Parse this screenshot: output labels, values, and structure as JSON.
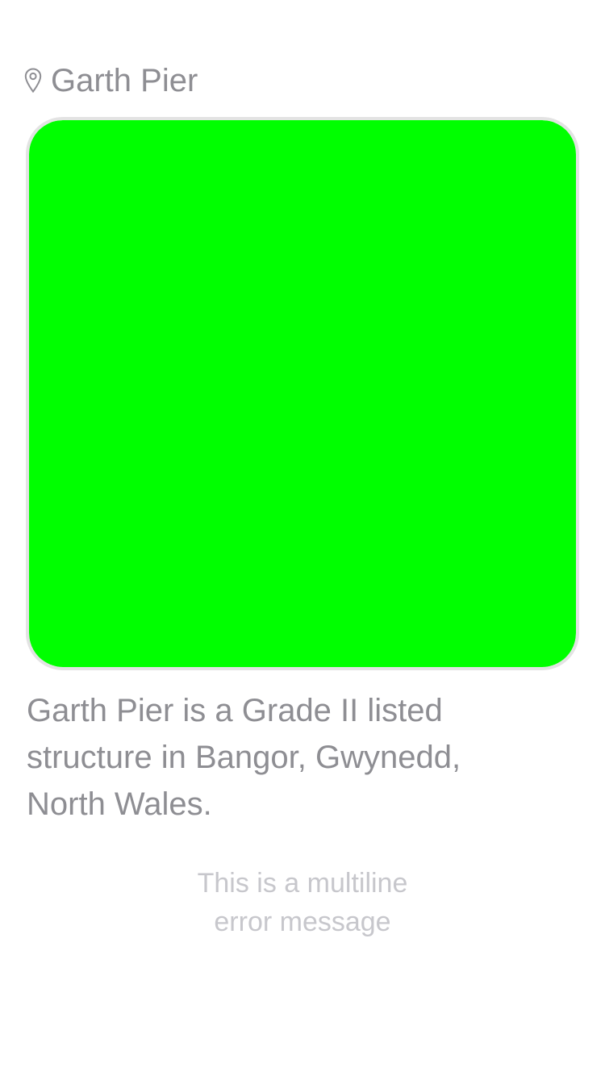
{
  "location": {
    "icon": "location-pin-icon",
    "name": "Garth Pier"
  },
  "image": {
    "fill_color": "#00ff00",
    "border_color": "#e3e3e3"
  },
  "description": "Garth Pier is a Grade II listed structure in Bangor, Gwynedd, North Wales.",
  "error": {
    "lines": [
      "This is a multiline",
      "error message"
    ]
  }
}
